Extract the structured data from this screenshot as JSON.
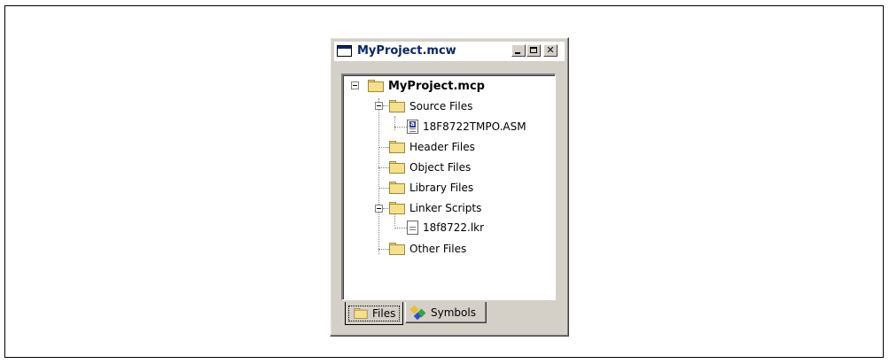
{
  "window": {
    "title": "MyProject.mcw"
  },
  "tree": {
    "root": "MyProject.mcp",
    "source_files": "Source Files",
    "source_file_asm": "18F8722TMPO.ASM",
    "header_files": "Header Files",
    "object_files": "Object Files",
    "library_files": "Library Files",
    "linker_scripts": "Linker Scripts",
    "linker_file": "18f8722.lkr",
    "other_files": "Other Files"
  },
  "tabs": {
    "files": "Files",
    "symbols": "Symbols"
  },
  "icons": [
    "folder-icon",
    "asm-file-icon",
    "text-file-icon",
    "symbols-icon",
    "collapse-icon"
  ],
  "colors": {
    "titlebar_text": "#0a246a",
    "window_face": "#d4d0c8",
    "folder": "#f6e08a"
  }
}
